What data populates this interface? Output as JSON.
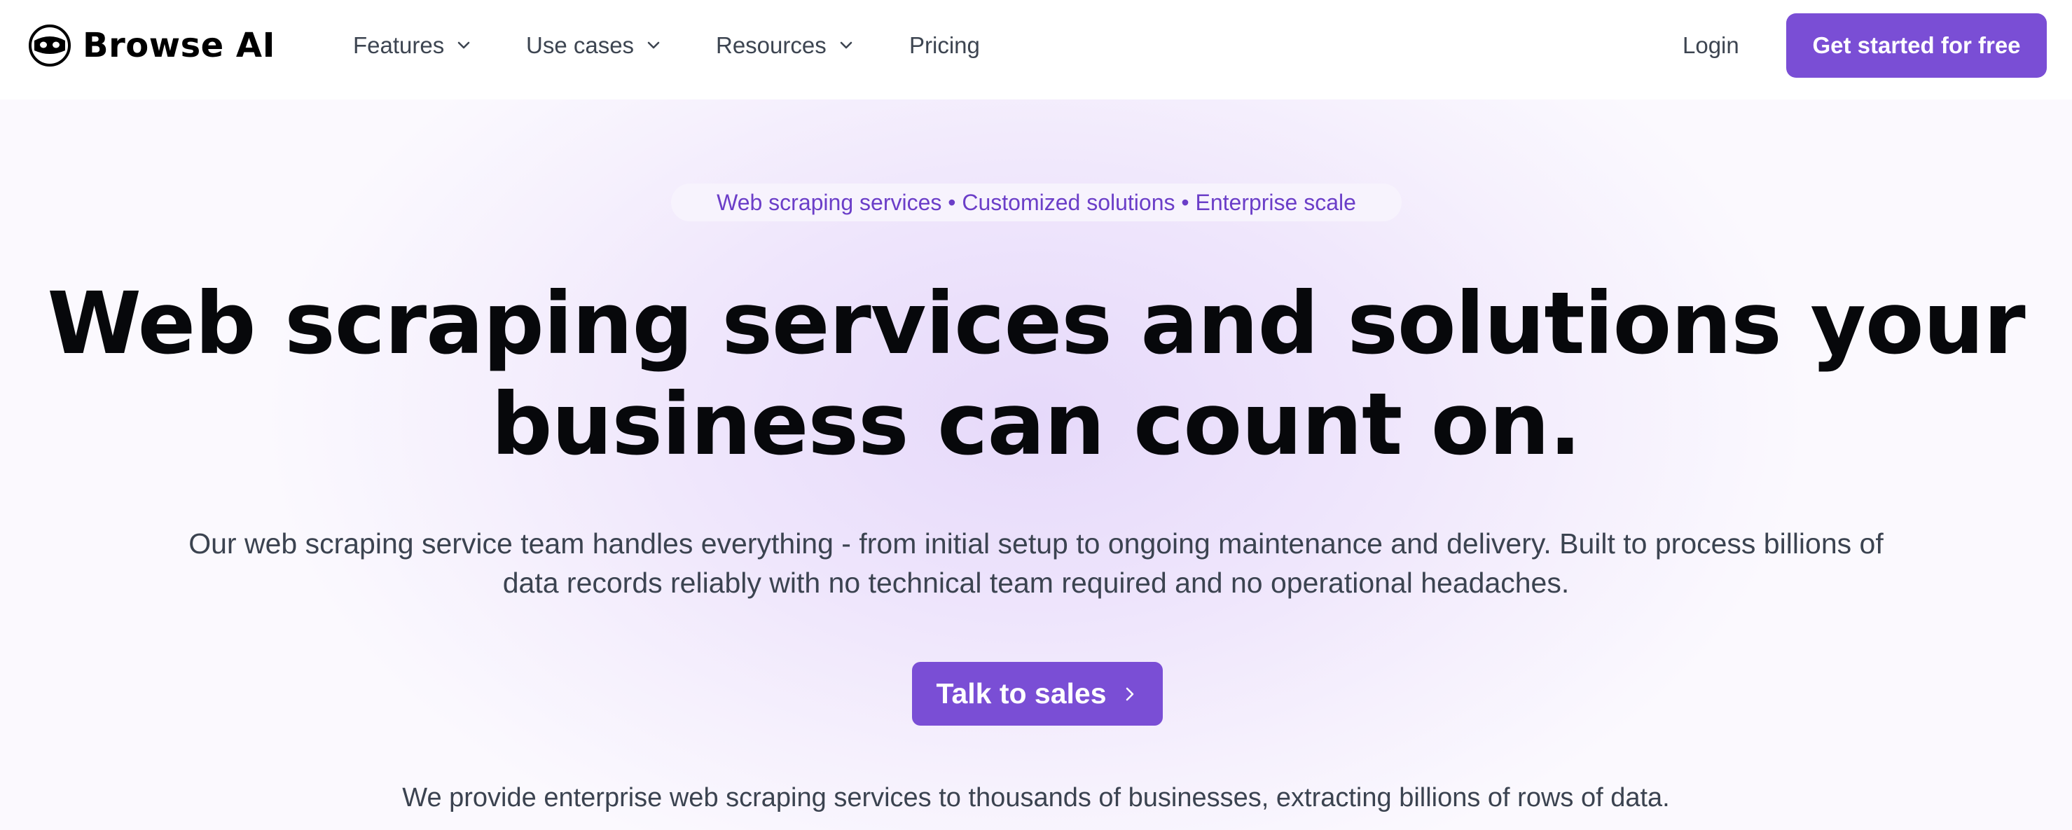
{
  "brand": {
    "name": "Browse AI",
    "logo_icon": "robot-face-icon"
  },
  "nav": {
    "items": [
      {
        "label": "Features",
        "icon": "chevron-down-icon"
      },
      {
        "label": "Use cases",
        "icon": "chevron-down-icon"
      },
      {
        "label": "Resources",
        "icon": "chevron-down-icon"
      },
      {
        "label": "Pricing"
      }
    ],
    "login_label": "Login",
    "cta_label": "Get started for free"
  },
  "hero": {
    "pill_text": "Web scraping services • Customized solutions • Enterprise scale",
    "headline_lines": [
      "Web scraping services and solutions your",
      "business can count on."
    ],
    "subtext_lines": [
      "Our web scraping service team handles everything - from initial setup to ongoing maintenance and delivery. Built to process billions of",
      "data records reliably with no technical team required and no operational headaches."
    ],
    "cta_label": "Talk to sales",
    "cta_icon": "chevron-right-icon",
    "footnote": "We provide enterprise web scraping services to thousands of businesses, extracting billions of rows of data."
  },
  "colors": {
    "accent": "#7a4ed5",
    "pill_text": "#6b3ec8",
    "heading": "#07080b",
    "body_text": "#3b4350",
    "nav_text": "#3d4551"
  }
}
